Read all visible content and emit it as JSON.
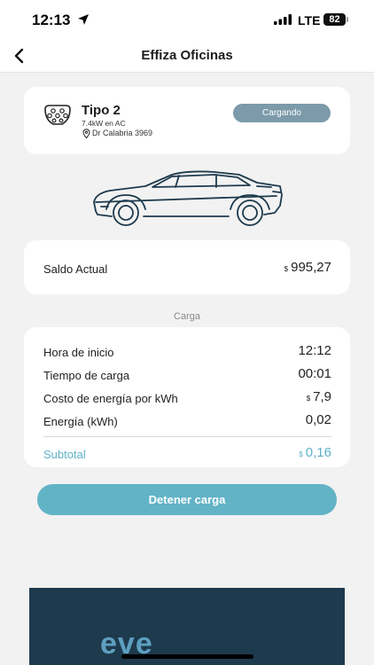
{
  "status_bar": {
    "time": "12:13",
    "network": "LTE",
    "battery": "82"
  },
  "nav": {
    "title": "Effiza Oficinas",
    "back_icon": "chevron-left-icon"
  },
  "connector": {
    "type": "Tipo 2",
    "power": "7.4kW en AC",
    "address": "Dr Calabria 3969",
    "status": "Cargando",
    "icon": "type2-plug-icon"
  },
  "balance": {
    "label": "Saldo Actual",
    "currency": "$",
    "value": "995,27"
  },
  "charge": {
    "section_title": "Carga",
    "rows": [
      {
        "label": "Hora de inicio",
        "currency": "",
        "value": "12:12"
      },
      {
        "label": "Tiempo de carga",
        "currency": "",
        "value": "00:01"
      },
      {
        "label": "Costo de energía por kWh",
        "currency": "$",
        "value": "7,9"
      },
      {
        "label": "Energía (kWh)",
        "currency": "",
        "value": "0,02"
      }
    ],
    "subtotal": {
      "label": "Subtotal",
      "currency": "$",
      "value": "0,16"
    }
  },
  "actions": {
    "stop_label": "Detener carga"
  },
  "banner": {
    "text": "eve"
  },
  "colors": {
    "accent": "#62b3c6",
    "badge": "#7c9aaa",
    "banner_bg": "#1e3a4d",
    "background": "#f2f2f2"
  }
}
